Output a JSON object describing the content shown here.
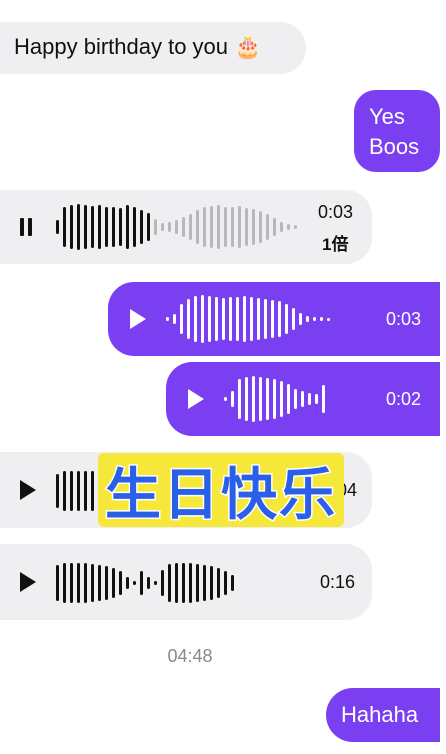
{
  "messages": {
    "m1": {
      "text": "Happy birthday to you 🎂"
    },
    "m2": {
      "line1": "Yes",
      "line2": "Boos"
    },
    "m3": {
      "duration": "0:03",
      "speed": "1倍",
      "state": "pause-icon"
    },
    "m4": {
      "duration": "0:03",
      "state": "play-icon"
    },
    "m5": {
      "duration": "0:02",
      "state": "play-icon"
    },
    "m6": {
      "duration": "0:04",
      "state": "play-icon"
    },
    "m7": {
      "duration": "0:16",
      "state": "play-icon"
    },
    "m8": {
      "text": "Hahaha"
    }
  },
  "overlay": {
    "text": "生日快乐"
  },
  "timestamp": "04:48",
  "colors": {
    "outgoing": "#7a3ff0",
    "incoming": "#efeff2",
    "overlay_bg": "#f5e83a",
    "overlay_text": "#2a5fe8"
  }
}
